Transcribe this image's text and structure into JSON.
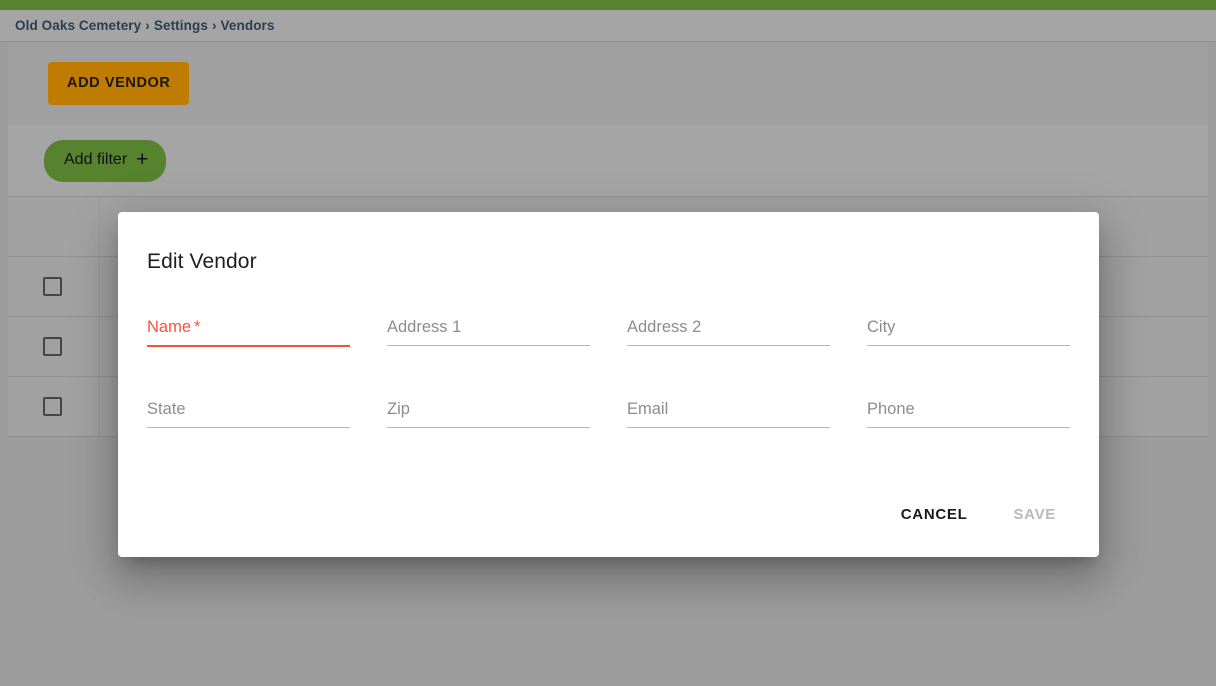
{
  "app": {
    "accent_green": "#5e8c32",
    "accent_orange": "#cc8400",
    "error_red": "#f3543f"
  },
  "breadcrumb": {
    "items": [
      {
        "label": "Old Oaks Cemetery"
      },
      {
        "label": "Settings"
      },
      {
        "label": "Vendors"
      }
    ],
    "separator": "›"
  },
  "toolbar": {
    "add_vendor_label": "ADD VENDOR"
  },
  "filters": {
    "add_filter_label": "Add filter",
    "add_filter_icon": "plus-icon",
    "plus_glyph": "+"
  },
  "table": {
    "rows": [
      {
        "selected": false
      },
      {
        "selected": false
      },
      {
        "selected": false
      }
    ]
  },
  "dialog": {
    "title": "Edit Vendor",
    "fields": [
      {
        "label": "Name",
        "value": "",
        "required": true,
        "error": true,
        "name": "name"
      },
      {
        "label": "Address 1",
        "value": "",
        "required": false,
        "error": false,
        "name": "address1"
      },
      {
        "label": "Address 2",
        "value": "",
        "required": false,
        "error": false,
        "name": "address2"
      },
      {
        "label": "City",
        "value": "",
        "required": false,
        "error": false,
        "name": "city"
      },
      {
        "label": "State",
        "value": "",
        "required": false,
        "error": false,
        "name": "state"
      },
      {
        "label": "Zip",
        "value": "",
        "required": false,
        "error": false,
        "name": "zip"
      },
      {
        "label": "Email",
        "value": "",
        "required": false,
        "error": false,
        "name": "email"
      },
      {
        "label": "Phone",
        "value": "",
        "required": false,
        "error": false,
        "name": "phone"
      }
    ],
    "required_marker": "*",
    "cancel_label": "CANCEL",
    "save_label": "SAVE",
    "save_enabled": false
  }
}
